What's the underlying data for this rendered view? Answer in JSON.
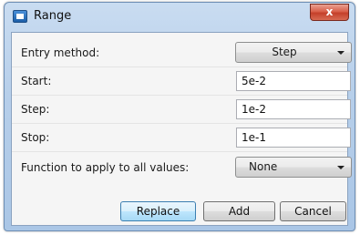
{
  "window": {
    "title": "Range",
    "close_glyph": "x"
  },
  "rows": {
    "entry_method": {
      "label": "Entry method:",
      "value": "Step"
    },
    "start": {
      "label": "Start:",
      "value": "5e-2"
    },
    "step": {
      "label": "Step:",
      "value": "1e-2"
    },
    "stop": {
      "label": "Stop:",
      "value": "1e-1"
    },
    "function": {
      "label": "Function to apply to all values:",
      "value": "None"
    }
  },
  "buttons": {
    "replace": "Replace",
    "add": "Add",
    "cancel": "Cancel"
  },
  "icons": {
    "app": "window-app-icon",
    "close": "close-icon",
    "dropdown": "chevron-down-icon"
  }
}
